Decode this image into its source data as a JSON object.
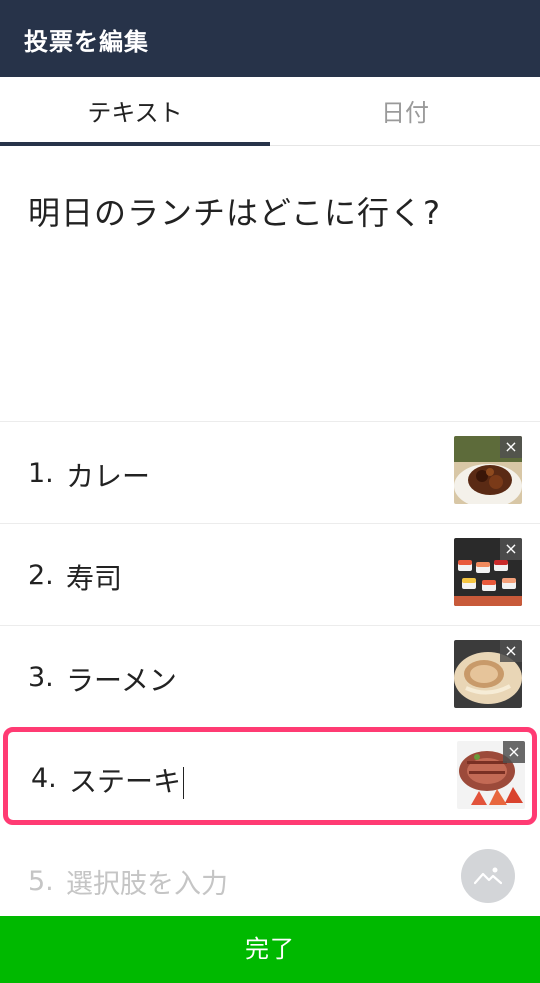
{
  "header": {
    "title": "投票を編集"
  },
  "tabs": [
    {
      "label": "テキスト",
      "active": true
    },
    {
      "label": "日付",
      "active": false
    }
  ],
  "question": "明日のランチはどこに行く?",
  "options": [
    {
      "number": "1.",
      "text": "カレー",
      "image": "curry-photo",
      "remove": "×"
    },
    {
      "number": "2.",
      "text": "寿司",
      "image": "sushi-photo",
      "remove": "×"
    },
    {
      "number": "3.",
      "text": "ラーメン",
      "image": "ramen-photo",
      "remove": "×"
    },
    {
      "number": "4.",
      "text": "ステーキ",
      "image": "steak-photo",
      "remove": "×",
      "focused": true
    }
  ],
  "new_option": {
    "number": "5.",
    "placeholder": "選択肢を入力",
    "icon": "image-icon"
  },
  "done_button": "完了",
  "colors": {
    "header": "#273349",
    "accent_border": "#ff3b73",
    "done": "#00b900"
  }
}
